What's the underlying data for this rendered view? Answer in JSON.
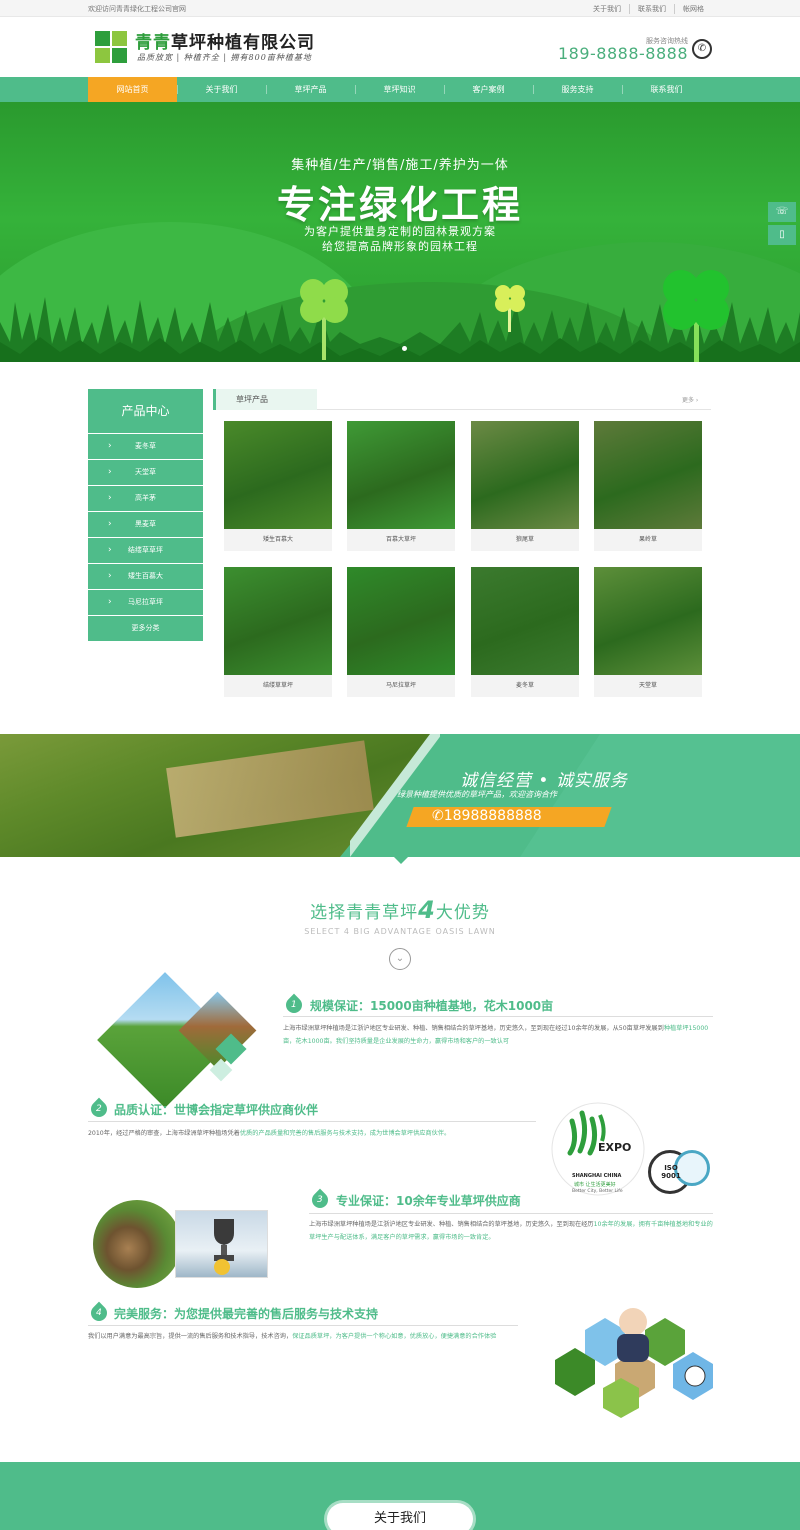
{
  "topbar": {
    "welcome": "欢迎访问青青绿化工程公司官网",
    "links": [
      "关于我们",
      "联系我们",
      "帐网格"
    ]
  },
  "header": {
    "company_hl": "青青",
    "company_rest": "草坪种植有限公司",
    "slogan": "品质放宽 | 种植齐全 | 拥有800亩种植基地",
    "hotline_label": "服务咨询热线",
    "hotline_number": "189-8888-8888"
  },
  "nav": {
    "items": [
      "网站首页",
      "关于我们",
      "草坪产品",
      "草坪知识",
      "客户案例",
      "服务支持",
      "联系我们"
    ],
    "active_index": 0
  },
  "banner": {
    "subtitle": "集种植/生产/销售/施工/养护为一体",
    "title": "专注绿化工程",
    "line1": "为客户提供量身定制的园林景观方案",
    "line2": "给您提高品牌形象的园林工程"
  },
  "categories": {
    "title": "产品中心",
    "items": [
      "麦冬草",
      "天堂草",
      "高羊茅",
      "黑麦草",
      "结缕草草坪",
      "矮生百慕大",
      "马尼拉草坪"
    ],
    "more": "更多分类"
  },
  "products": {
    "tab": "草坪产品",
    "more": "更多 ›",
    "items": [
      {
        "name": "矮生百慕大",
        "tone": "#4a8a2a"
      },
      {
        "name": "百慕大草坪",
        "tone": "#3f9a36"
      },
      {
        "name": "狼尾草",
        "tone": "#6c8a45"
      },
      {
        "name": "果岭草",
        "tone": "#5e7a3a"
      },
      {
        "name": "结缕草草坪",
        "tone": "#3c8f30"
      },
      {
        "name": "马尼拉草坪",
        "tone": "#2f8a2a"
      },
      {
        "name": "麦冬草",
        "tone": "#3b7a2e"
      },
      {
        "name": "天堂草",
        "tone": "#5d8f3a"
      }
    ]
  },
  "integrity": {
    "title": "诚信经营 • 诚实服务",
    "subtitle": "绿景种植提供优质的草坪产品，欢迎咨询合作",
    "phone": "18988888888"
  },
  "advantages": {
    "title_pre": "选择青青草坪",
    "title_num": "4",
    "title_post": "大优势",
    "en": "SELECT 4 BIG ADVANTAGE OASIS LAWN",
    "items": [
      {
        "num": "1",
        "head": "规模保证：15000亩种植基地，花木1000亩",
        "text_a": "上海市绿洲草坪种植场是江浙沪地区专业研发、种植、销售相结合的草坪基地，历史悠久，至到现在经过10余年的发展，从50亩草坪发展到",
        "text_b": "种植草坪15000亩，花木1000亩。我们坚持质量是企业发展的生命力，赢得市场和客户的一致认可"
      },
      {
        "num": "2",
        "head": "品质认证：世博会指定草坪供应商伙伴",
        "text_a": "2010年，经过严格的审查，上海市绿洲草坪种植场凭着",
        "text_b": "优质的产品质量和完善的售后服务与技术支持，成为世博会草坪供应商伙伴。"
      },
      {
        "num": "3",
        "head": "专业保证：10余年专业草坪供应商",
        "text_a": "上海市绿洲草坪种植场是江浙沪地区专业研发、种植、销售相结合的草坪基地，历史悠久，至到现在经历",
        "text_b": "10余年的发展，拥有千亩种植基地和专业的草坪生产与配送体系，满足客户的草坪需求，赢得市场的一致肯定。"
      },
      {
        "num": "4",
        "head": "完美服务：为您提供最完善的售后服务与技术支持",
        "text_a": "我们以用户满意为最高宗旨，提供一流的售后服务和技术指导，技术咨询，",
        "text_b": "保证品质草坪，为客户提供一个称心如意，优质放心，便捷满意的合作体验"
      }
    ],
    "expo_text": "EXPO",
    "expo_sub": "SHANGHAI CHINA",
    "expo_motto": "城市 让生活更美好",
    "expo_motto_en": "Better City, Better Life",
    "iso_text": "ISO 9001"
  },
  "bottom": {
    "about_button": "关于我们"
  },
  "colors": {
    "brand": "#4fbc8a",
    "accent": "#f5a623",
    "banner_green": "#35b23a"
  }
}
